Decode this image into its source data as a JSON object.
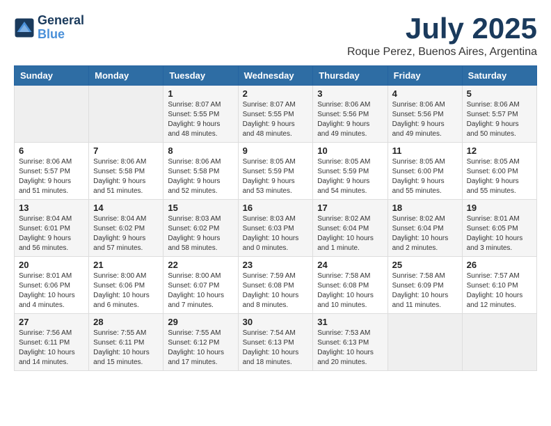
{
  "header": {
    "logo_line1": "General",
    "logo_line2": "Blue",
    "month": "July 2025",
    "location": "Roque Perez, Buenos Aires, Argentina"
  },
  "weekdays": [
    "Sunday",
    "Monday",
    "Tuesday",
    "Wednesday",
    "Thursday",
    "Friday",
    "Saturday"
  ],
  "weeks": [
    [
      {
        "day": "",
        "info": ""
      },
      {
        "day": "",
        "info": ""
      },
      {
        "day": "1",
        "info": "Sunrise: 8:07 AM\nSunset: 5:55 PM\nDaylight: 9 hours\nand 48 minutes."
      },
      {
        "day": "2",
        "info": "Sunrise: 8:07 AM\nSunset: 5:55 PM\nDaylight: 9 hours\nand 48 minutes."
      },
      {
        "day": "3",
        "info": "Sunrise: 8:06 AM\nSunset: 5:56 PM\nDaylight: 9 hours\nand 49 minutes."
      },
      {
        "day": "4",
        "info": "Sunrise: 8:06 AM\nSunset: 5:56 PM\nDaylight: 9 hours\nand 49 minutes."
      },
      {
        "day": "5",
        "info": "Sunrise: 8:06 AM\nSunset: 5:57 PM\nDaylight: 9 hours\nand 50 minutes."
      }
    ],
    [
      {
        "day": "6",
        "info": "Sunrise: 8:06 AM\nSunset: 5:57 PM\nDaylight: 9 hours\nand 51 minutes."
      },
      {
        "day": "7",
        "info": "Sunrise: 8:06 AM\nSunset: 5:58 PM\nDaylight: 9 hours\nand 51 minutes."
      },
      {
        "day": "8",
        "info": "Sunrise: 8:06 AM\nSunset: 5:58 PM\nDaylight: 9 hours\nand 52 minutes."
      },
      {
        "day": "9",
        "info": "Sunrise: 8:05 AM\nSunset: 5:59 PM\nDaylight: 9 hours\nand 53 minutes."
      },
      {
        "day": "10",
        "info": "Sunrise: 8:05 AM\nSunset: 5:59 PM\nDaylight: 9 hours\nand 54 minutes."
      },
      {
        "day": "11",
        "info": "Sunrise: 8:05 AM\nSunset: 6:00 PM\nDaylight: 9 hours\nand 55 minutes."
      },
      {
        "day": "12",
        "info": "Sunrise: 8:05 AM\nSunset: 6:00 PM\nDaylight: 9 hours\nand 55 minutes."
      }
    ],
    [
      {
        "day": "13",
        "info": "Sunrise: 8:04 AM\nSunset: 6:01 PM\nDaylight: 9 hours\nand 56 minutes."
      },
      {
        "day": "14",
        "info": "Sunrise: 8:04 AM\nSunset: 6:02 PM\nDaylight: 9 hours\nand 57 minutes."
      },
      {
        "day": "15",
        "info": "Sunrise: 8:03 AM\nSunset: 6:02 PM\nDaylight: 9 hours\nand 58 minutes."
      },
      {
        "day": "16",
        "info": "Sunrise: 8:03 AM\nSunset: 6:03 PM\nDaylight: 10 hours\nand 0 minutes."
      },
      {
        "day": "17",
        "info": "Sunrise: 8:02 AM\nSunset: 6:04 PM\nDaylight: 10 hours\nand 1 minute."
      },
      {
        "day": "18",
        "info": "Sunrise: 8:02 AM\nSunset: 6:04 PM\nDaylight: 10 hours\nand 2 minutes."
      },
      {
        "day": "19",
        "info": "Sunrise: 8:01 AM\nSunset: 6:05 PM\nDaylight: 10 hours\nand 3 minutes."
      }
    ],
    [
      {
        "day": "20",
        "info": "Sunrise: 8:01 AM\nSunset: 6:06 PM\nDaylight: 10 hours\nand 4 minutes."
      },
      {
        "day": "21",
        "info": "Sunrise: 8:00 AM\nSunset: 6:06 PM\nDaylight: 10 hours\nand 6 minutes."
      },
      {
        "day": "22",
        "info": "Sunrise: 8:00 AM\nSunset: 6:07 PM\nDaylight: 10 hours\nand 7 minutes."
      },
      {
        "day": "23",
        "info": "Sunrise: 7:59 AM\nSunset: 6:08 PM\nDaylight: 10 hours\nand 8 minutes."
      },
      {
        "day": "24",
        "info": "Sunrise: 7:58 AM\nSunset: 6:08 PM\nDaylight: 10 hours\nand 10 minutes."
      },
      {
        "day": "25",
        "info": "Sunrise: 7:58 AM\nSunset: 6:09 PM\nDaylight: 10 hours\nand 11 minutes."
      },
      {
        "day": "26",
        "info": "Sunrise: 7:57 AM\nSunset: 6:10 PM\nDaylight: 10 hours\nand 12 minutes."
      }
    ],
    [
      {
        "day": "27",
        "info": "Sunrise: 7:56 AM\nSunset: 6:11 PM\nDaylight: 10 hours\nand 14 minutes."
      },
      {
        "day": "28",
        "info": "Sunrise: 7:55 AM\nSunset: 6:11 PM\nDaylight: 10 hours\nand 15 minutes."
      },
      {
        "day": "29",
        "info": "Sunrise: 7:55 AM\nSunset: 6:12 PM\nDaylight: 10 hours\nand 17 minutes."
      },
      {
        "day": "30",
        "info": "Sunrise: 7:54 AM\nSunset: 6:13 PM\nDaylight: 10 hours\nand 18 minutes."
      },
      {
        "day": "31",
        "info": "Sunrise: 7:53 AM\nSunset: 6:13 PM\nDaylight: 10 hours\nand 20 minutes."
      },
      {
        "day": "",
        "info": ""
      },
      {
        "day": "",
        "info": ""
      }
    ]
  ]
}
